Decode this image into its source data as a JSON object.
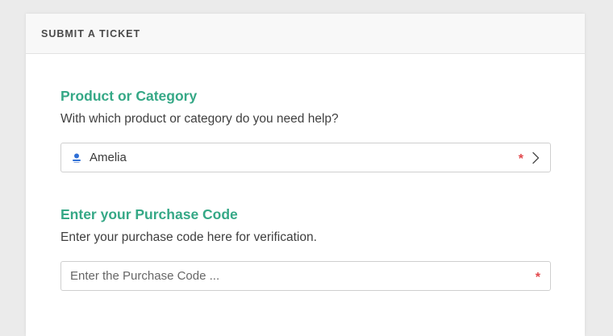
{
  "card": {
    "header_title": "SUBMIT A TICKET"
  },
  "product_section": {
    "title": "Product or Category",
    "description": "With which product or category do you need help?",
    "selected_value": "Amelia",
    "logo_icon": "amelia-logo-icon",
    "required_mark": "*",
    "chevron_icon": "chevron-right-icon"
  },
  "purchase_section": {
    "title": "Enter your Purchase Code",
    "description": "Enter your purchase code here for verification.",
    "input_value": "",
    "placeholder": "Enter the Purchase Code ...",
    "required_mark": "*"
  },
  "colors": {
    "accent": "#35a886",
    "required": "#e2474b"
  }
}
